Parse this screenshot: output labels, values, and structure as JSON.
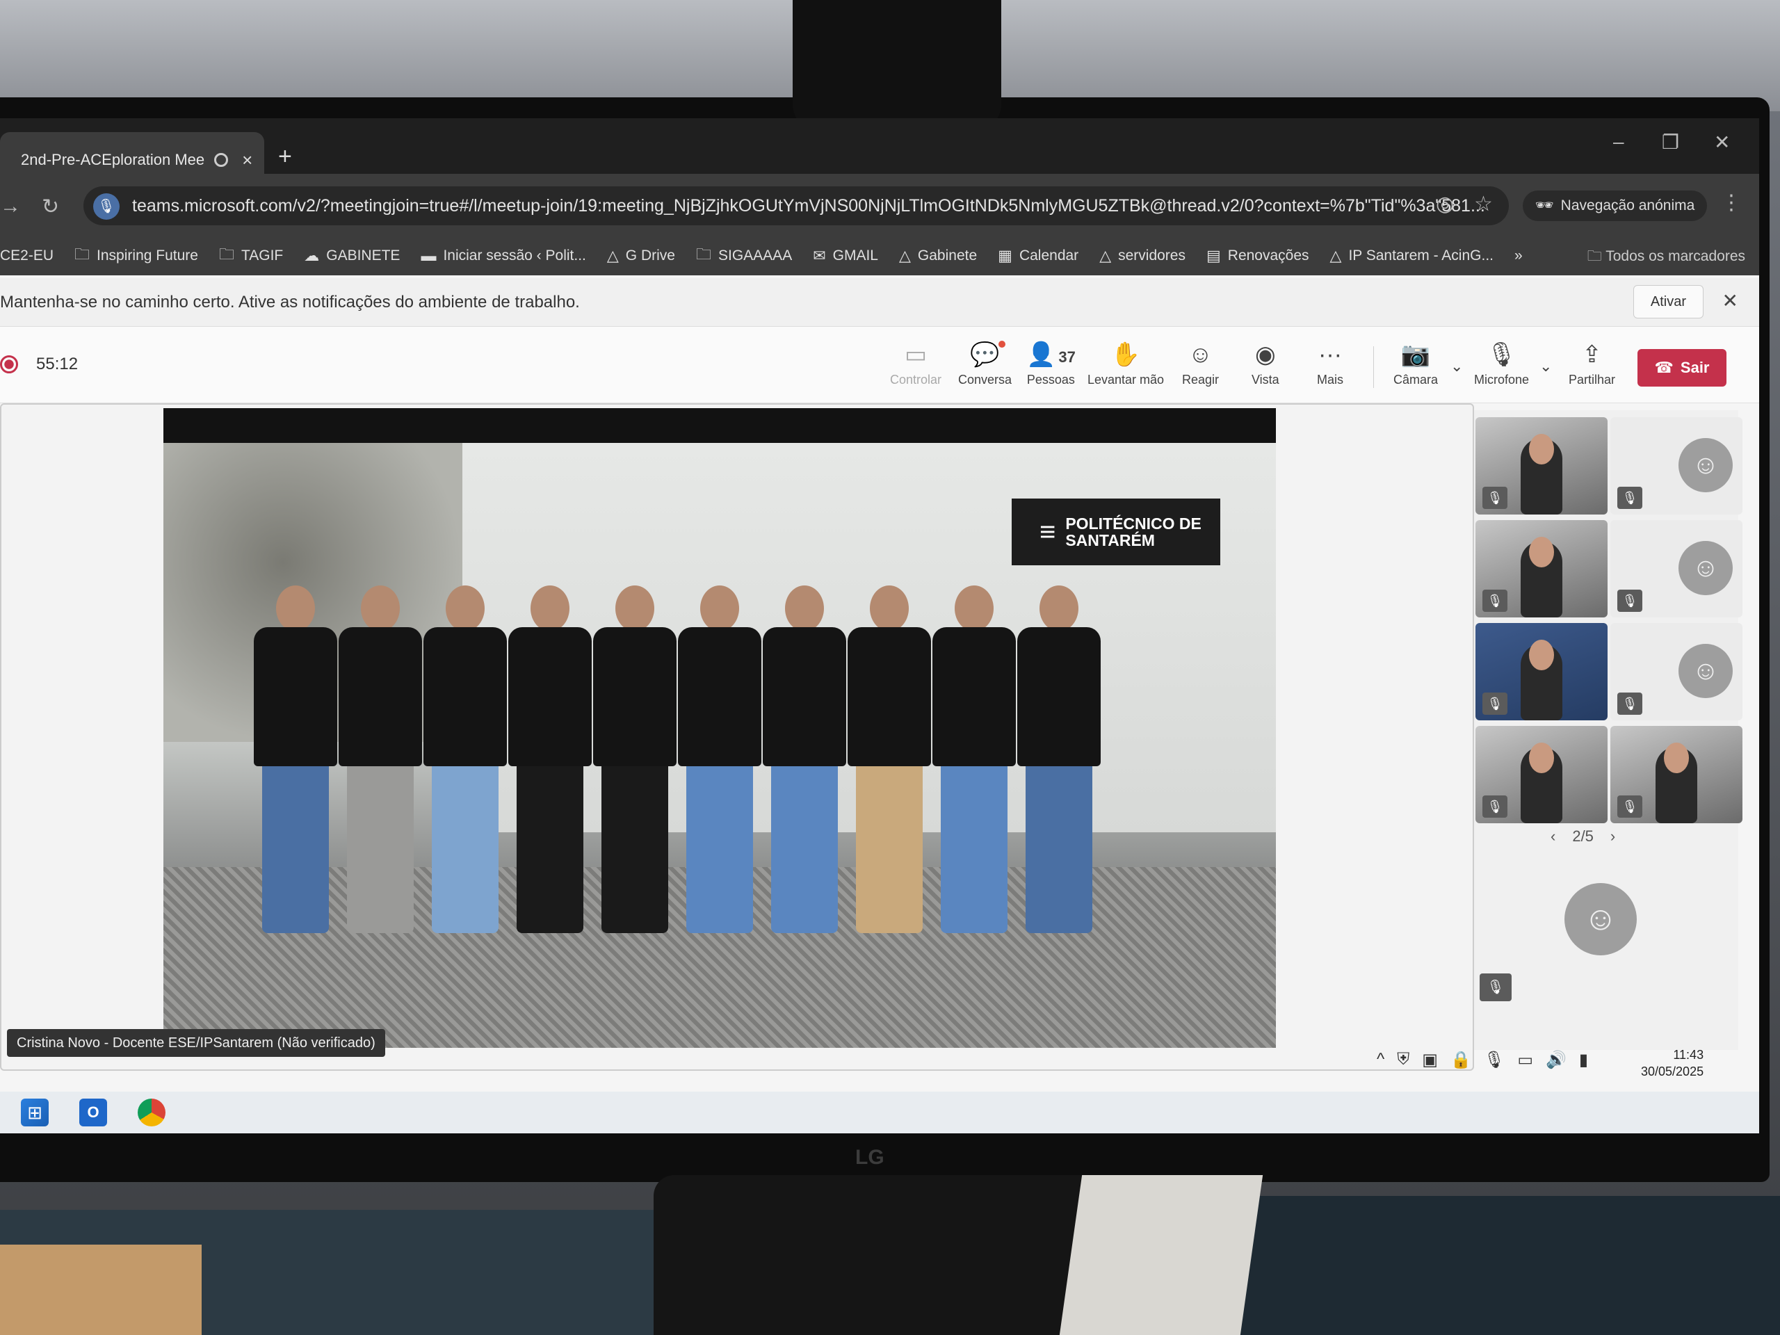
{
  "browser": {
    "tab_title": "2nd-Pre-ACEploration Mee",
    "new_tab": "+",
    "url": "teams.microsoft.com/v2/?meetingjoin=true#/l/meetup-join/19:meeting_NjBjZjhkOGUtYmVjNS00NjNjLTlmOGItNDk5NmlyMGU5ZTBk@thread.v2/0?context=%7b\"Tid\"%3a\"581...",
    "incognito_label": "Navegação anónima",
    "bookmarks": [
      {
        "label": "CE2-EU",
        "icon": "folder-icon"
      },
      {
        "label": "Inspiring Future",
        "icon": "folder-icon"
      },
      {
        "label": "TAGIF",
        "icon": "folder-icon"
      },
      {
        "label": "GABINETE",
        "icon": "cloud-icon"
      },
      {
        "label": "Iniciar sessão ‹ Polit...",
        "icon": "site-icon"
      },
      {
        "label": "G Drive",
        "icon": "drive-icon"
      },
      {
        "label": "SIGAAAAA",
        "icon": "folder-icon"
      },
      {
        "label": "GMAIL",
        "icon": "gmail-icon"
      },
      {
        "label": "Gabinete",
        "icon": "drive-icon"
      },
      {
        "label": "Calendar",
        "icon": "calendar-icon"
      },
      {
        "label": "servidores",
        "icon": "drive-icon"
      },
      {
        "label": "Renovações",
        "icon": "docs-icon"
      },
      {
        "label": "IP Santarem - AcinG...",
        "icon": "drive-icon"
      }
    ],
    "more_bookmarks": "»",
    "all_bookmarks": "Todos os marcadores"
  },
  "notification": {
    "message": "Mantenha-se no caminho certo. Ative as notificações do ambiente de trabalho.",
    "action": "Ativar"
  },
  "meeting": {
    "elapsed": "55:12",
    "controls": {
      "controlar": "Controlar",
      "conversa": "Conversa",
      "pessoas": "Pessoas",
      "pessoas_count": "37",
      "levantar": "Levantar mão",
      "reagir": "Reagir",
      "vista": "Vista",
      "mais": "Mais",
      "camara": "Câmara",
      "microfone": "Microfone",
      "partilhar": "Partilhar",
      "sair": "Sair"
    },
    "presenter_name": "Cristina Novo - Docente ESE/IPSantarem (Não verificado)",
    "video_logo": "POLITÉCNICO DE SANTARÉM",
    "pager": "2/5"
  },
  "system": {
    "time": "11:43",
    "date": "30/05/2025"
  },
  "colors": {
    "leave_button": "#c4314b",
    "chat_badge": "#e2513e"
  }
}
